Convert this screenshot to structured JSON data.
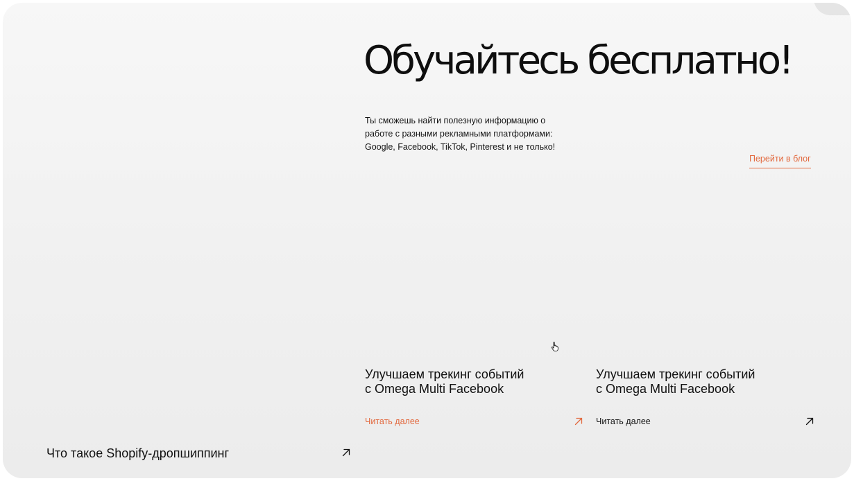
{
  "hero": {
    "title": "Обучайтесь бесплатно!",
    "description": "Ты сможешь найти полезную информацию о работе с разными рекламными платформами: Google, Facebook, TikTok, Pinterest и не только!",
    "blog_link": "Перейти в блог"
  },
  "cards": [
    {
      "title_line1": "Улучшаем трекинг событий",
      "title_line2": "с Omega Multi Facebook",
      "read_more": "Читать далее",
      "arrow_icon": "arrow-up-right-icon",
      "accent": "#e2683d"
    },
    {
      "title_line1": "Улучшаем трекинг событий",
      "title_line2": "с Omega Multi Facebook",
      "read_more": "Читать далее",
      "arrow_icon": "arrow-up-right-icon",
      "accent": "#111111"
    }
  ],
  "bottom_left": {
    "title": "Что такое Shopify-дропшиппинг",
    "arrow_icon": "arrow-up-right-icon"
  },
  "colors": {
    "accent": "#e2683d",
    "text": "#111111",
    "background": "#f1f1f1"
  }
}
